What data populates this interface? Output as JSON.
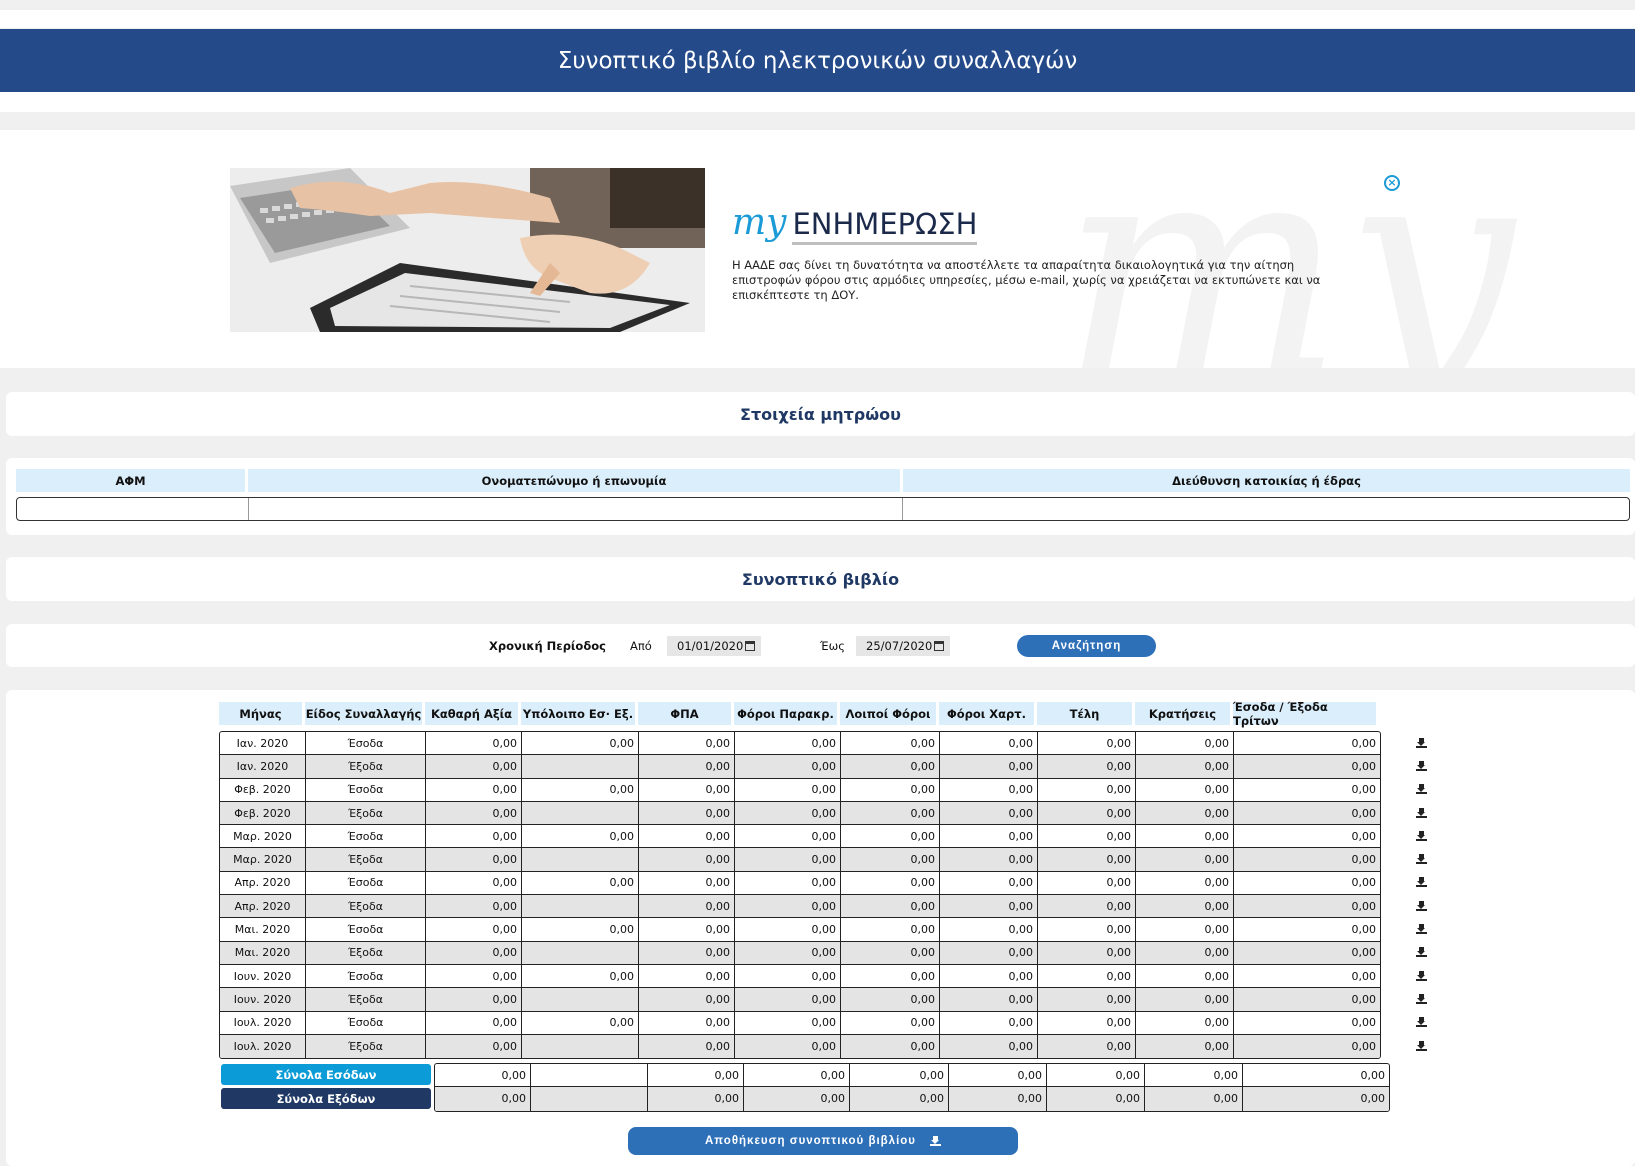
{
  "header": {
    "title": "Συνοπτικό βιβλίο ηλεκτρονικών συναλλαγών"
  },
  "promo": {
    "logo_prefix": "my",
    "logo_word": "ΕΝΗΜΕΡΩΣΗ",
    "watermark": "my",
    "text": "Η ΑΑΔΕ σας δίνει τη δυνατότητα να αποστέλλετε τα απαραίτητα δικαιολογητικά για την αίτηση επιστροφών φόρου στις αρμόδιες υπηρεσίες, μέσω e-mail, χωρίς να χρειάζεται να εκτυπώνετε και να επισκέπτεστε τη ΔΟΥ.",
    "close_icon": "close-circle-icon"
  },
  "registry": {
    "title": "Στοιχεία μητρώου",
    "columns": [
      "ΑΦΜ",
      "Ονοματεπώνυμο ή επωνυμία",
      "Διεύθυνση κατοικίας ή έδρας"
    ],
    "values": [
      "",
      "",
      ""
    ]
  },
  "book": {
    "title": "Συνοπτικό βιβλίο"
  },
  "filter": {
    "period_label": "Χρονική Περίοδος",
    "from_label": "Από",
    "from_value": "01/01/2020",
    "to_label": "Έως",
    "to_value": "25/07/2020",
    "search_button": "Αναζήτηση"
  },
  "table": {
    "columns": [
      "Μήνας",
      "Είδος Συναλλαγής",
      "Καθαρή Αξία",
      "Υπόλοιπο Εσ· Εξ.",
      "ΦΠΑ",
      "Φόροι Παρακρ.",
      "Λοιποί Φόροι",
      "Φόροι Χαρτ.",
      "Τέλη",
      "Κρατήσεις",
      "Έσοδα / Έξοδα Τρίτων"
    ],
    "rows": [
      [
        "Ιαν. 2020",
        "Έσοδα",
        "0,00",
        "0,00",
        "0,00",
        "0,00",
        "0,00",
        "0,00",
        "0,00",
        "0,00",
        "0,00"
      ],
      [
        "Ιαν. 2020",
        "Έξοδα",
        "0,00",
        "",
        "0,00",
        "0,00",
        "0,00",
        "0,00",
        "0,00",
        "0,00",
        "0,00"
      ],
      [
        "Φεβ. 2020",
        "Έσοδα",
        "0,00",
        "0,00",
        "0,00",
        "0,00",
        "0,00",
        "0,00",
        "0,00",
        "0,00",
        "0,00"
      ],
      [
        "Φεβ. 2020",
        "Έξοδα",
        "0,00",
        "",
        "0,00",
        "0,00",
        "0,00",
        "0,00",
        "0,00",
        "0,00",
        "0,00"
      ],
      [
        "Μαρ. 2020",
        "Έσοδα",
        "0,00",
        "0,00",
        "0,00",
        "0,00",
        "0,00",
        "0,00",
        "0,00",
        "0,00",
        "0,00"
      ],
      [
        "Μαρ. 2020",
        "Έξοδα",
        "0,00",
        "",
        "0,00",
        "0,00",
        "0,00",
        "0,00",
        "0,00",
        "0,00",
        "0,00"
      ],
      [
        "Απρ. 2020",
        "Έσοδα",
        "0,00",
        "0,00",
        "0,00",
        "0,00",
        "0,00",
        "0,00",
        "0,00",
        "0,00",
        "0,00"
      ],
      [
        "Απρ. 2020",
        "Έξοδα",
        "0,00",
        "",
        "0,00",
        "0,00",
        "0,00",
        "0,00",
        "0,00",
        "0,00",
        "0,00"
      ],
      [
        "Μαι. 2020",
        "Έσοδα",
        "0,00",
        "0,00",
        "0,00",
        "0,00",
        "0,00",
        "0,00",
        "0,00",
        "0,00",
        "0,00"
      ],
      [
        "Μαι. 2020",
        "Έξοδα",
        "0,00",
        "",
        "0,00",
        "0,00",
        "0,00",
        "0,00",
        "0,00",
        "0,00",
        "0,00"
      ],
      [
        "Ιουν. 2020",
        "Έσοδα",
        "0,00",
        "0,00",
        "0,00",
        "0,00",
        "0,00",
        "0,00",
        "0,00",
        "0,00",
        "0,00"
      ],
      [
        "Ιουν. 2020",
        "Έξοδα",
        "0,00",
        "",
        "0,00",
        "0,00",
        "0,00",
        "0,00",
        "0,00",
        "0,00",
        "0,00"
      ],
      [
        "Ιουλ. 2020",
        "Έσοδα",
        "0,00",
        "0,00",
        "0,00",
        "0,00",
        "0,00",
        "0,00",
        "0,00",
        "0,00",
        "0,00"
      ],
      [
        "Ιουλ. 2020",
        "Έξοδα",
        "0,00",
        "",
        "0,00",
        "0,00",
        "0,00",
        "0,00",
        "0,00",
        "0,00",
        "0,00"
      ]
    ],
    "row_icon": "download-icon"
  },
  "totals": {
    "income_label": "Σύνολα Εσόδων",
    "expense_label": "Σύνολα Εξόδων",
    "income_color": "#0b9bd7",
    "expense_color": "#1f3864",
    "income": [
      "0,00",
      "",
      "0,00",
      "0,00",
      "0,00",
      "0,00",
      "0,00",
      "0,00",
      "0,00"
    ],
    "expense": [
      "0,00",
      "",
      "0,00",
      "0,00",
      "0,00",
      "0,00",
      "0,00",
      "0,00",
      "0,00"
    ]
  },
  "save": {
    "label": "Αποθήκευση συνοπτικού βιβλίου",
    "icon": "download-icon"
  },
  "colors": {
    "header": "#244a8a",
    "accent": "#2e70b8",
    "head_cell": "#dbeefb",
    "title": "#1f3864"
  }
}
